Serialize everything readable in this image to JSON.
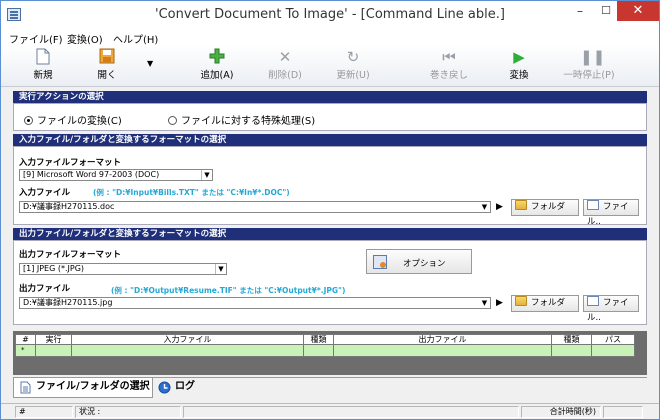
{
  "window": {
    "title": "'Convert Document To Image' - [Command Line able.]",
    "min_label": "–",
    "max_label": "☐",
    "close_label": "✕"
  },
  "menu": [
    "ファイル(F)",
    "変換(O)",
    "ヘルプ(H)"
  ],
  "toolbar": {
    "new": "新規",
    "open": "開く",
    "add": "追加(A)",
    "delete": "削除(D)",
    "update": "更新(U)",
    "rewind": "巻き戻し",
    "convert": "変換",
    "pause": "一時停止(P)",
    "dropdown_arrow": "▼"
  },
  "action_section": {
    "header": "実行アクションの選択",
    "radio_convert": "ファイルの変換(C)",
    "radio_special": "ファイルに対する特殊処理(S)"
  },
  "input_section": {
    "header": "入力ファイル/フォルダと変換するフォーマットの選択",
    "format_label": "入力ファイルフォーマット",
    "format_value": "[9] Microsoft Word 97-2003 (DOC)",
    "file_label": "入力ファイル",
    "file_hint": "(例 : \"D:¥Input¥Bills.TXT\" または \"C:¥In¥*.DOC\")",
    "file_value": "D:¥議事録H270115.doc",
    "folder_button": "フォルダ",
    "file_button": "ファイル..",
    "play": "▶",
    "arrow": "▼"
  },
  "output_section": {
    "header": "出力ファイル/フォルダと変換するフォーマットの選択",
    "format_label": "出力ファイルフォーマット",
    "format_value": "[1] JPEG (*.JPG)",
    "option_button": "オプション",
    "file_label": "出力ファイル",
    "file_hint": "(例 : \"D:¥Output¥Resume.TIF\" または \"C:¥Output¥*.JPG\")",
    "file_value": "D:¥議事録H270115.jpg",
    "folder_button": "フォルダ",
    "file_button": "ファイル..",
    "play": "▶",
    "arrow": "▼"
  },
  "grid": {
    "columns": [
      "#",
      "実行",
      "入力ファイル",
      "種類",
      "出力ファイル",
      "種類",
      "パス"
    ],
    "row_marker": "*"
  },
  "tabs": {
    "files": "ファイル/フォルダの選択",
    "log": "ログ"
  },
  "status": {
    "count": "#",
    "state": "状況 :",
    "total": "合計時間(秒)"
  },
  "colors": {
    "section_header": "#1f2f7a",
    "grid_row": "#c9f2b8",
    "hint": "#26a9d6",
    "close_button": "#c7372f"
  }
}
